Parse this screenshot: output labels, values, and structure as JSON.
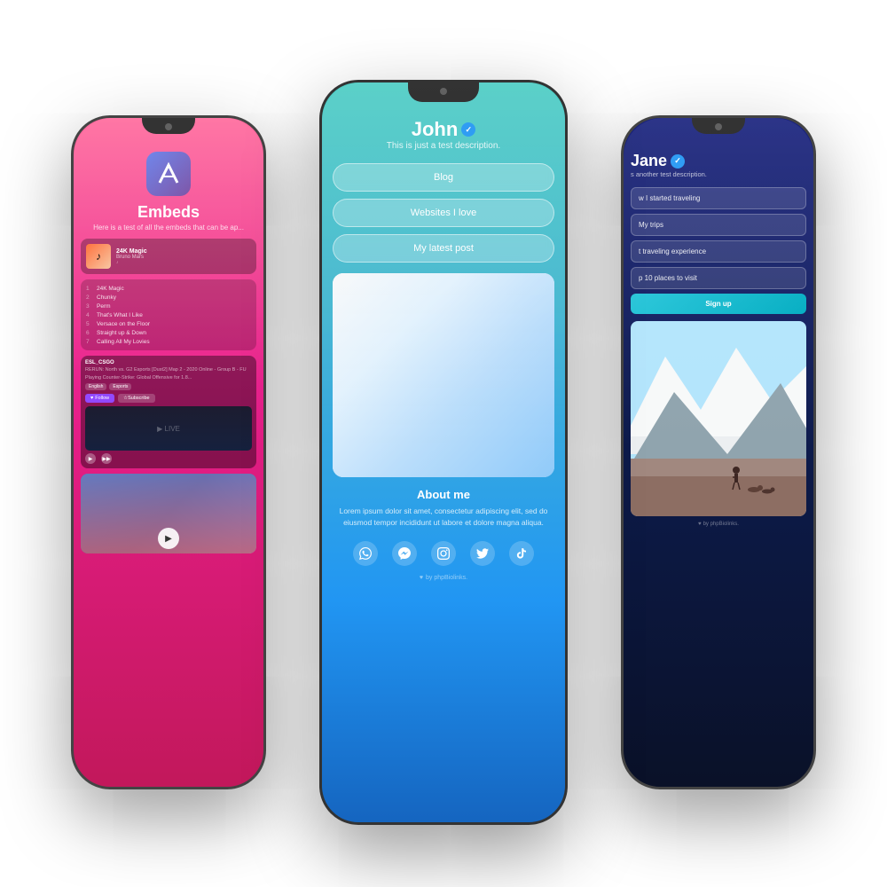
{
  "left_phone": {
    "logo_alt": "Affinity logo",
    "title": "Embeds",
    "subtitle": "Here is a test of all the embeds that can be ap...",
    "music": {
      "title": "24K Magic",
      "artist": "Bruno Mars",
      "playlist": [
        {
          "num": "1",
          "title": "24K Magic"
        },
        {
          "num": "2",
          "title": "Chunky"
        },
        {
          "num": "3",
          "title": "Perm"
        },
        {
          "num": "4",
          "title": "That's What I Like"
        },
        {
          "num": "5",
          "title": "Versace on the Floor"
        },
        {
          "num": "6",
          "title": "Straight up & Down"
        },
        {
          "num": "7",
          "title": "Calling All My Lovies"
        }
      ]
    },
    "twitch": {
      "title": "ESL_CSGO",
      "subtitle": "RERUN: North vs. G2 Esports [Dust2] Map 2 - 2020 Online - Group B - FU",
      "game": "Playing Counter-Strike: Global Offensive for 1.8...",
      "tags": [
        "English",
        "Esports"
      ],
      "follow_label": "Follow",
      "subscribe_label": "Subscribe"
    }
  },
  "center_phone": {
    "name": "John",
    "verified": "✓",
    "description": "This is just a test description.",
    "links": [
      {
        "label": "Blog"
      },
      {
        "label": "Websites I love"
      },
      {
        "label": "My latest post"
      }
    ],
    "about_title": "About me",
    "about_text": "Lorem ipsum dolor sit amet, consectetur adipiscing elit, sed do eiusmod tempor incididunt ut labore et dolore magna aliqua.",
    "social_icons": [
      "whatsapp",
      "messenger",
      "instagram",
      "twitter",
      "tiktok"
    ],
    "footer": "by phpBiolinks."
  },
  "right_phone": {
    "name": "Jane",
    "verified": "✓",
    "description": "s another test description.",
    "links": [
      {
        "label": "w I started traveling"
      },
      {
        "label": "My trips"
      },
      {
        "label": "t traveling experience"
      },
      {
        "label": "p 10 places to visit"
      }
    ],
    "signup_label": "Sign up",
    "footer": "by phpBiolinks."
  }
}
